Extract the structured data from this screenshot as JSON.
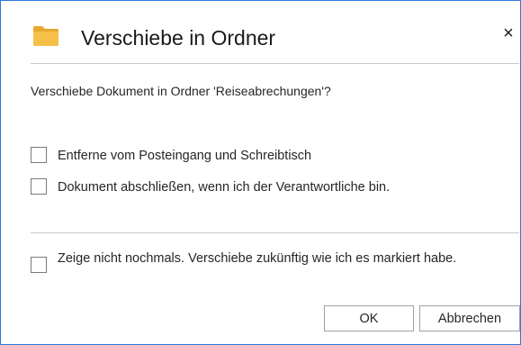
{
  "dialog": {
    "title": "Verschiebe in Ordner",
    "close_label": "×",
    "message": "Verschiebe Dokument in Ordner 'Reiseabrechungen'?",
    "options": [
      {
        "label": "Entferne vom Posteingang und Schreibtisch",
        "checked": false
      },
      {
        "label": "Dokument abschließen, wenn ich der Verantwortliche bin.",
        "checked": false
      }
    ],
    "dont_show_again": {
      "label": "Zeige nicht nochmals. Verschiebe zukünftig wie ich es markiert habe.",
      "checked": false
    },
    "buttons": {
      "ok": "OK",
      "cancel": "Abbrechen"
    },
    "icon": "folder-icon",
    "colors": {
      "border": "#2b7bd9",
      "folder": "#f5c04a"
    }
  }
}
